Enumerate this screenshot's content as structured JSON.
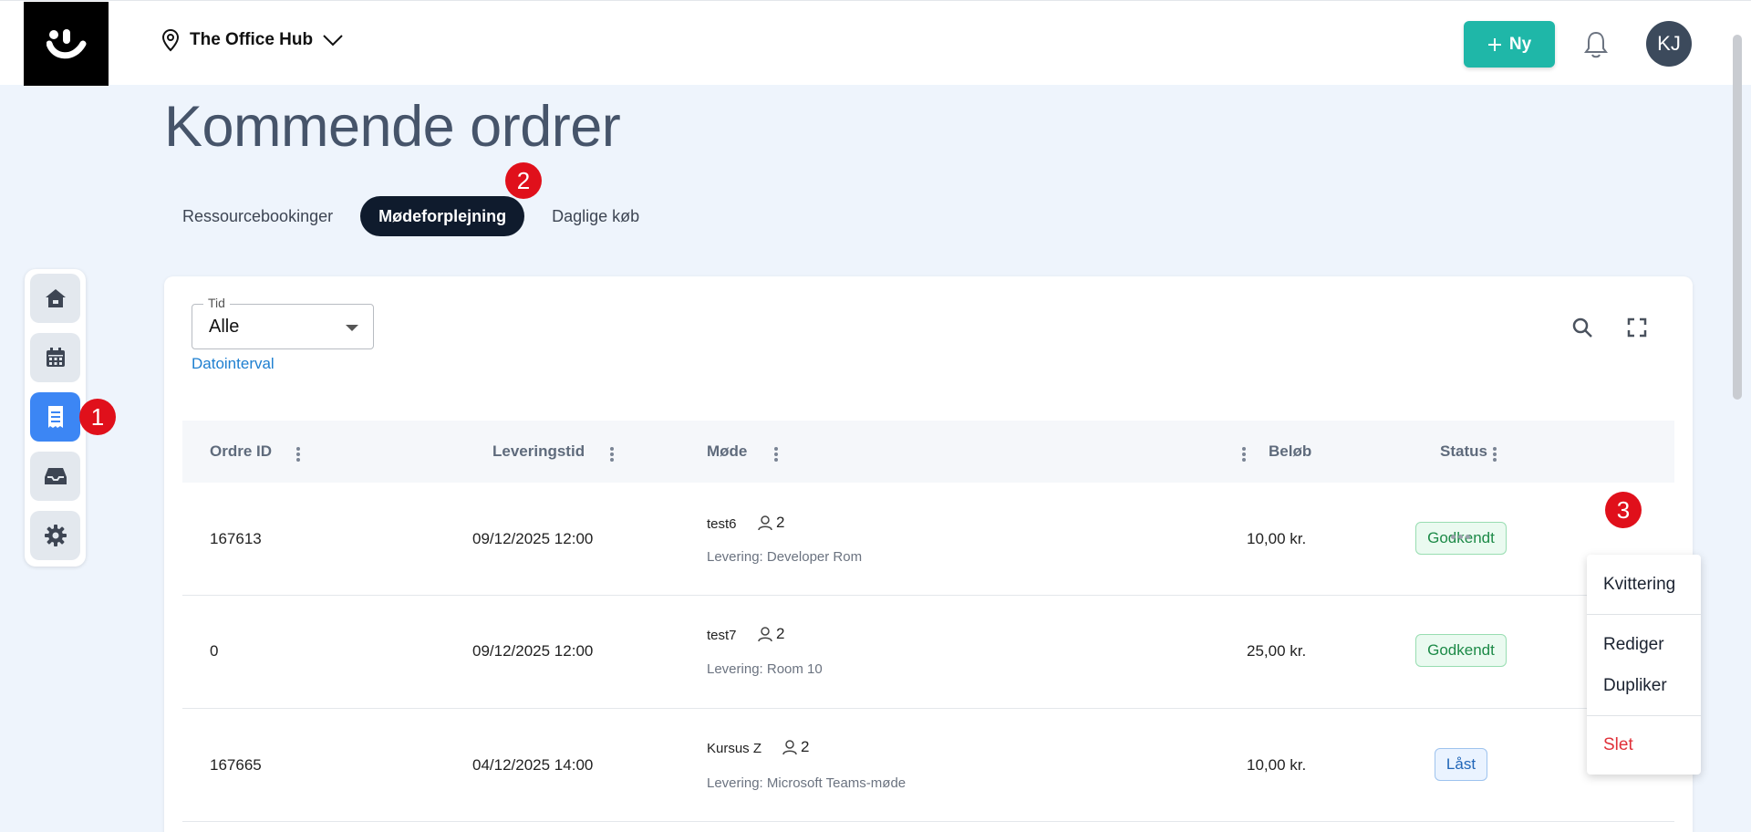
{
  "header": {
    "location": "The Office Hub",
    "new_button": "Ny",
    "avatar_initials": "KJ"
  },
  "page": {
    "title": "Kommende ordrer"
  },
  "tabs": [
    {
      "label": "Ressourcebookinger",
      "active": false
    },
    {
      "label": "Mødeforplejning",
      "active": true
    },
    {
      "label": "Daglige køb",
      "active": false
    }
  ],
  "annotations": [
    "1",
    "2",
    "3"
  ],
  "sidebar": {
    "items": [
      {
        "icon": "home-icon",
        "active": false
      },
      {
        "icon": "calendar-icon",
        "active": false
      },
      {
        "icon": "receipt-icon",
        "active": true
      },
      {
        "icon": "inbox-icon",
        "active": false
      },
      {
        "icon": "gear-icon",
        "active": false
      }
    ]
  },
  "filters": {
    "time_label": "Tid",
    "time_value": "Alle",
    "date_interval_link": "Datointerval"
  },
  "table": {
    "columns": [
      "Ordre ID",
      "Leveringstid",
      "Møde",
      "Beløb",
      "Status"
    ],
    "rows": [
      {
        "id": "167613",
        "time": "09/12/2025 12:00",
        "meeting": "test6",
        "guests": "2",
        "delivery": "Levering: Developer Rom",
        "amount": "10,00 kr.",
        "status": "Godkendt"
      },
      {
        "id": "0",
        "time": "09/12/2025 12:00",
        "meeting": "test7",
        "guests": "2",
        "delivery": "Levering: Room 10",
        "amount": "25,00 kr.",
        "status": "Godkendt"
      },
      {
        "id": "167665",
        "time": "04/12/2025 14:00",
        "meeting": "Kursus Z",
        "guests": "2",
        "delivery": "Levering: Microsoft Teams-møde",
        "amount": "10,00 kr.",
        "status": "Låst"
      }
    ]
  },
  "row_menu": {
    "items": [
      "Kvittering",
      "Rediger",
      "Dupliker",
      "Slet"
    ]
  },
  "colors": {
    "accent": "#1fb7a8",
    "active_tab": "#0f1b2d",
    "nav_active": "#3c86f4",
    "badge": "#e0101b"
  }
}
